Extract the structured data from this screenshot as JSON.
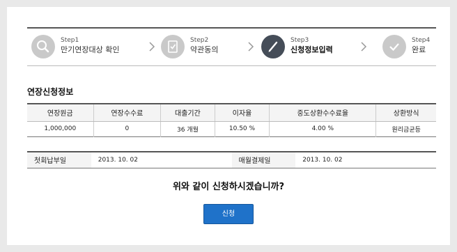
{
  "steps": [
    {
      "num": "Step1",
      "label": "만기연장대상 확인",
      "icon": "search-icon"
    },
    {
      "num": "Step2",
      "label": "약관동의",
      "icon": "document-check-icon"
    },
    {
      "num": "Step3",
      "label": "신청정보입력",
      "icon": "pen-icon",
      "active": true
    },
    {
      "num": "Step4",
      "label": "완료",
      "icon": "check-icon"
    }
  ],
  "section_title": "연장신청정보",
  "table": {
    "headers": [
      "연장원금",
      "연장수수료",
      "대출기간",
      "이자율",
      "중도상환수수료율",
      "상환방식"
    ],
    "row": [
      "1,000,000",
      "0",
      "36 개월",
      "10.50 %",
      "4.00 %",
      "원리금균등"
    ]
  },
  "payment": {
    "first_label": "첫회납부일",
    "first_value": "2013. 10. 02",
    "monthly_label": "매월결제일",
    "monthly_value": "2013. 10. 02"
  },
  "question": "위와 같이 신청하시겠습니까?",
  "apply_button": "신청",
  "colors": {
    "accent": "#1f72c9",
    "active_step": "#454d58",
    "inactive_step": "#c9c9c9"
  }
}
